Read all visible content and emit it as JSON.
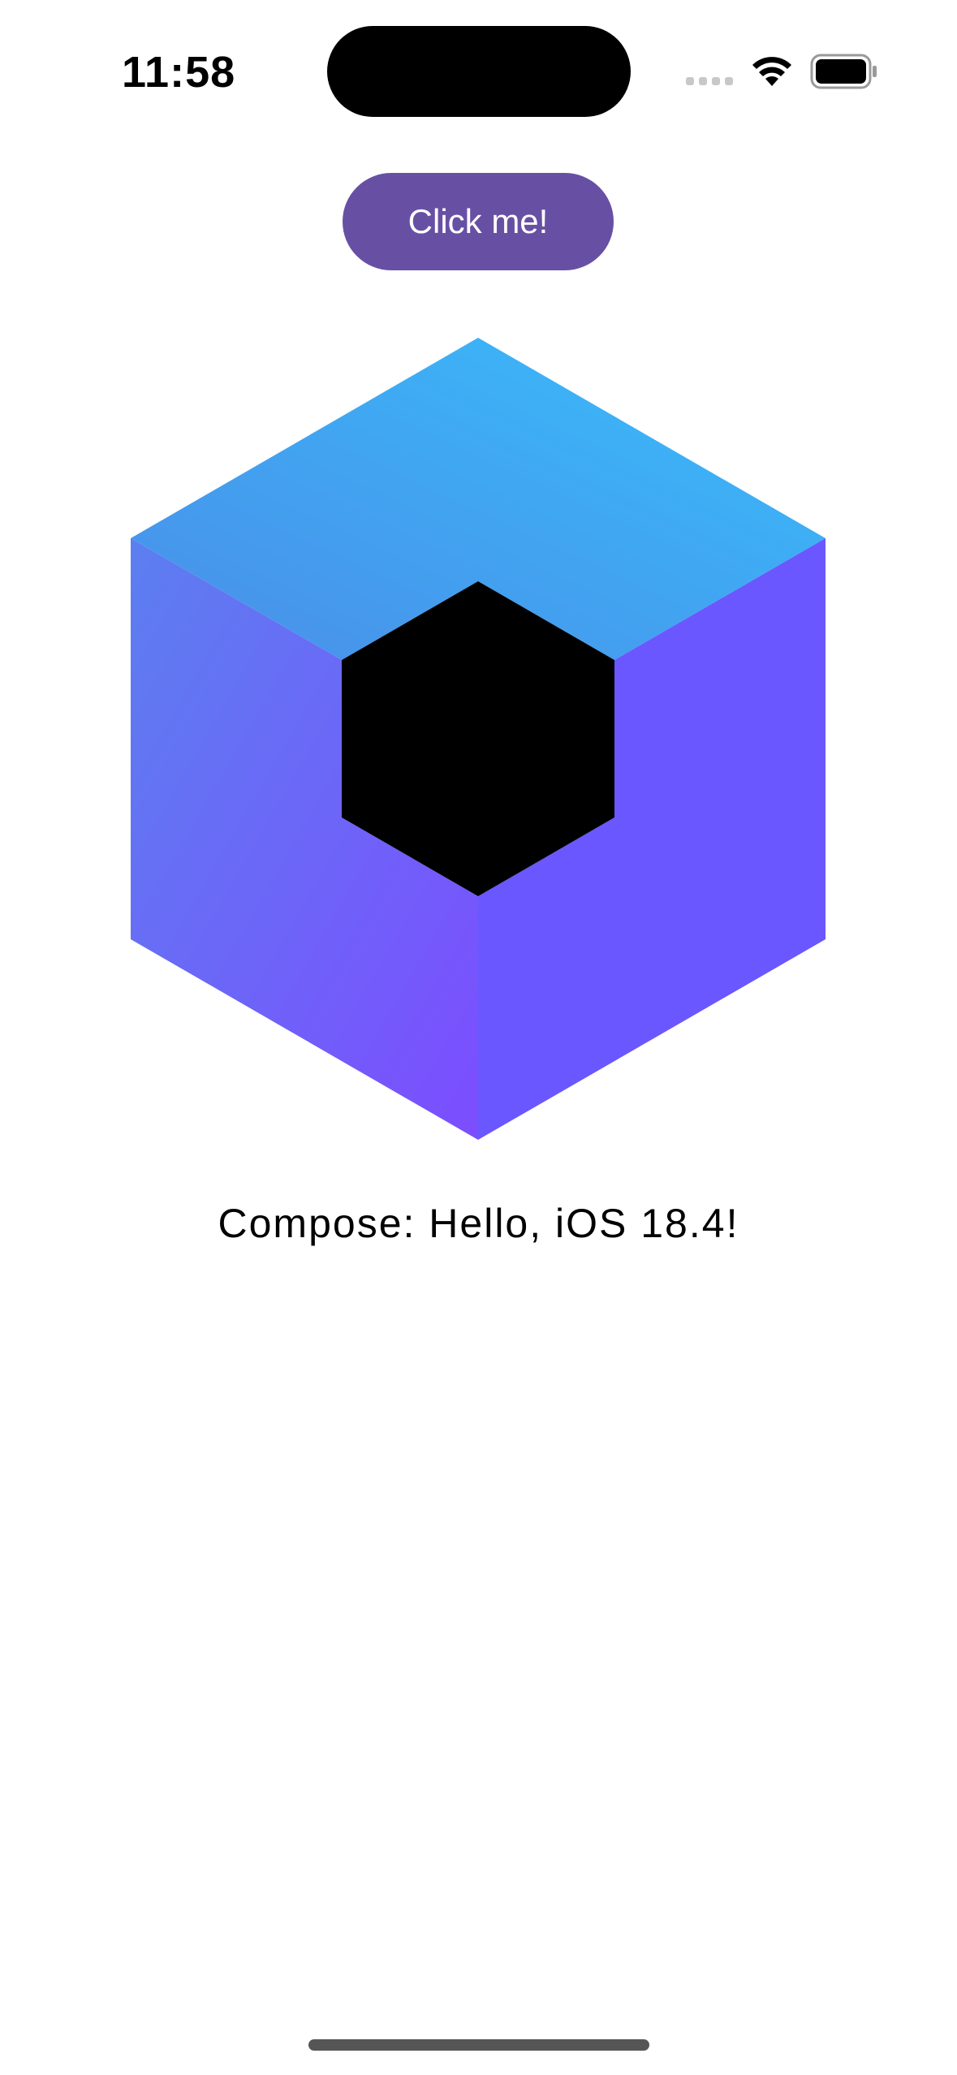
{
  "status_bar": {
    "time": "11:58",
    "icons": [
      "cellular-signal-icon",
      "wifi-icon",
      "battery-icon"
    ]
  },
  "main": {
    "button_label": "Click me!",
    "greeting": "Compose: Hello, iOS 18.4!",
    "logo": "compose-multiplatform-logo"
  },
  "colors": {
    "button": "#6750a4",
    "cube_top_start": "#4a8ee8",
    "cube_top_end": "#38bdfb",
    "cube_left_start": "#5c7ff0",
    "cube_left_end": "#7c4dff",
    "cube_right": "#6a57ff",
    "core": "#000000"
  }
}
